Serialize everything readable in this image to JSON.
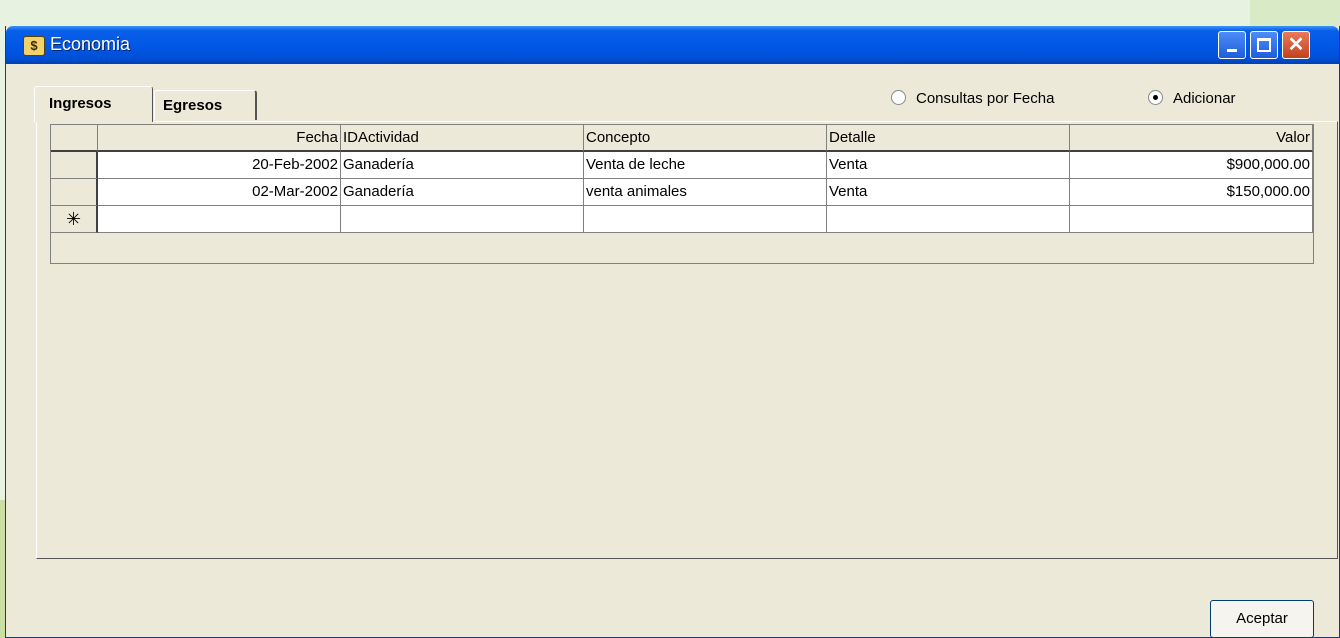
{
  "window": {
    "title": "Economia"
  },
  "tabs": [
    {
      "label": "Ingresos",
      "active": true
    },
    {
      "label": "Egresos",
      "active": false
    }
  ],
  "options": [
    {
      "label": "Consultas por Fecha",
      "checked": false
    },
    {
      "label": "Adicionar",
      "checked": true
    }
  ],
  "grid": {
    "columns": [
      "Fecha",
      "IDActividad",
      "Concepto",
      "Detalle",
      "Valor"
    ],
    "rows": [
      [
        "20-Feb-2002",
        "Ganadería",
        "Venta de leche",
        "Venta",
        "$900,000.00"
      ],
      [
        "02-Mar-2002",
        "Ganadería",
        "venta animales",
        "Venta",
        "$150,000.00"
      ]
    ],
    "new_row_marker": "✳"
  },
  "buttons": {
    "accept": "Aceptar"
  }
}
